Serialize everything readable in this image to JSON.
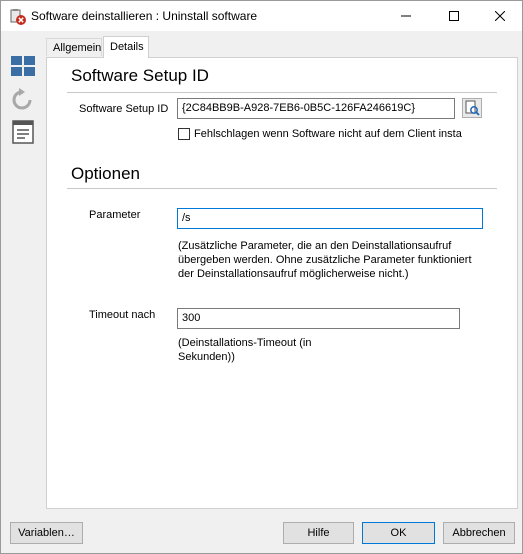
{
  "window": {
    "title": "Software deinstallieren : Uninstall software"
  },
  "titlebar_icons": [
    "app-uninstall-icon",
    "minimize-icon",
    "maximize-icon",
    "close-icon"
  ],
  "sidebar": {
    "icons": [
      "windows-icon",
      "refresh-icon",
      "document-list-icon"
    ]
  },
  "tabs": [
    {
      "label": "Allgemein",
      "active": false
    },
    {
      "label": "Details",
      "active": true
    }
  ],
  "sections": {
    "setup": {
      "title": "Software Setup ID",
      "id_label": "Software Setup ID",
      "id_value": "{2C84BB9B-A928-7EB6-0B5C-126FA246619C}",
      "checkbox_label": "Fehlschlagen wenn Software nicht auf dem Client insta",
      "checkbox_checked": false
    },
    "options": {
      "title": "Optionen",
      "param_label": "Parameter",
      "param_value": "/s",
      "param_help": "(Zusätzliche Parameter, die an den Deinstallationsaufruf übergeben werden. Ohne zusätzliche Parameter funktioniert der Deinstallationsaufruf möglicherweise nicht.)",
      "timeout_label": "Timeout nach",
      "timeout_value": "300",
      "timeout_help": "(Deinstallations-Timeout (in Sekunden))"
    }
  },
  "buttons": {
    "variables": "Variablen…",
    "help": "Hilfe",
    "ok": "OK",
    "cancel": "Abbrechen"
  },
  "colors": {
    "focus_border": "#0078d7",
    "icon_blue": "#3a6ea5",
    "close_red": "#c42b1c"
  }
}
